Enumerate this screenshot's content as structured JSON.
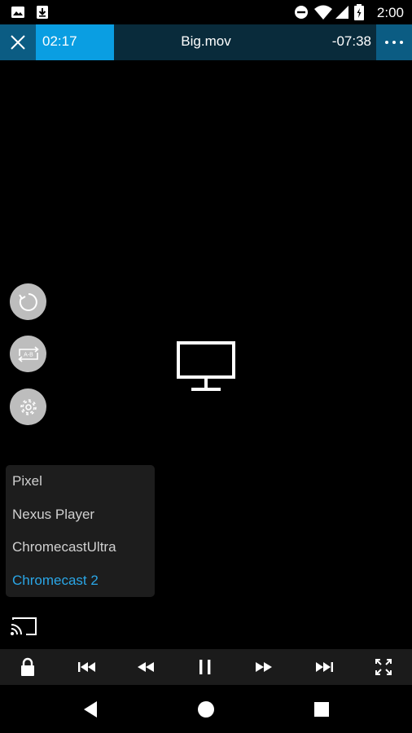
{
  "status_bar": {
    "time": "2:00",
    "icons": [
      "image-icon",
      "download-icon",
      "do-not-disturb-icon",
      "wifi-icon",
      "signal-icon",
      "battery-icon"
    ]
  },
  "player": {
    "elapsed": "02:17",
    "title": "Big.mov",
    "remaining": "-07:38",
    "progress": 0.23,
    "accent_color": "#0a9ee2"
  },
  "side_buttons": [
    "rotate-icon",
    "ab-repeat-icon",
    "settings-icon"
  ],
  "devices": [
    {
      "label": "Pixel",
      "selected": false
    },
    {
      "label": "Nexus Player",
      "selected": false
    },
    {
      "label": "ChromecastUltra",
      "selected": false
    },
    {
      "label": "Chromecast 2",
      "selected": true
    }
  ],
  "selected_color": "#2aa6e6",
  "controls": [
    "lock-icon",
    "skip-previous-icon",
    "rewind-icon",
    "pause-icon",
    "fast-forward-icon",
    "skip-next-icon",
    "fullscreen-icon"
  ],
  "nav": [
    "back-icon",
    "home-icon",
    "recents-icon"
  ]
}
